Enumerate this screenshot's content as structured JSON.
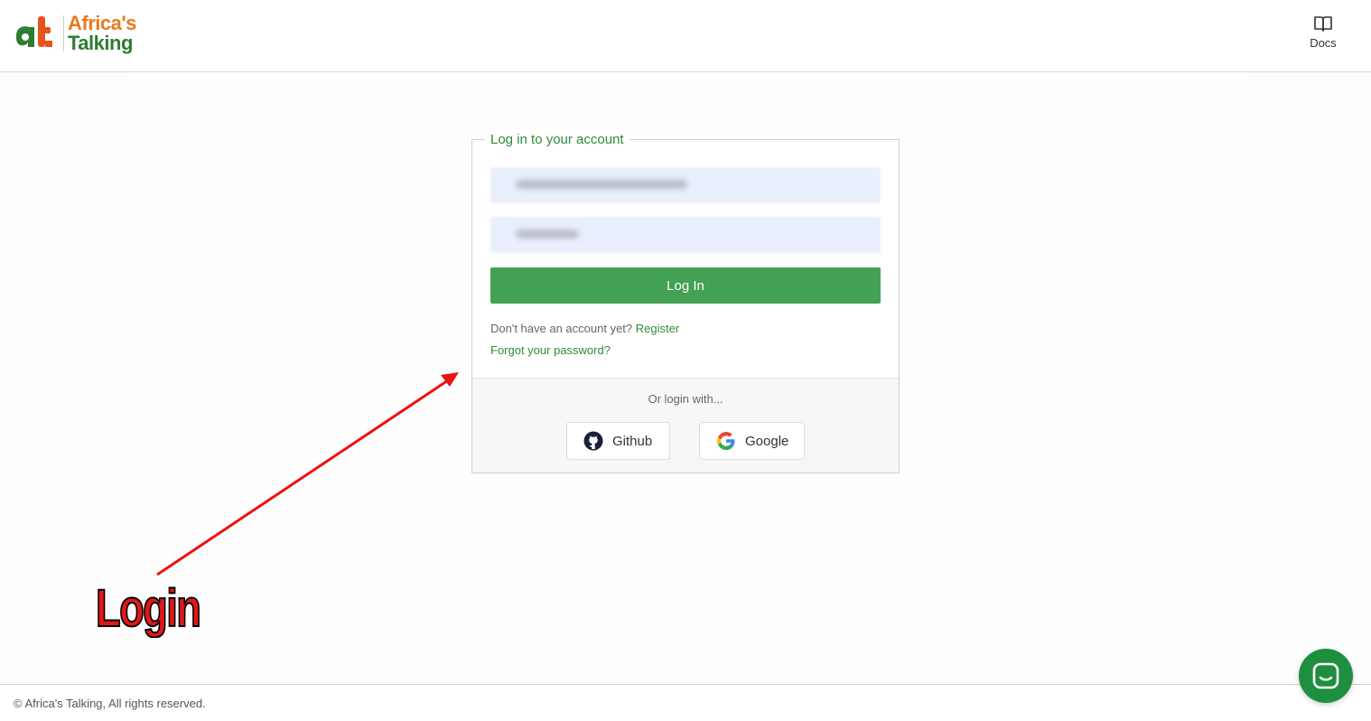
{
  "header": {
    "logo_line1": "Africa's",
    "logo_line2": "Talking",
    "docs_label": "Docs"
  },
  "login_card": {
    "legend": "Log in to your account",
    "login_button": "Log In",
    "no_account_text": "Don't have an account yet?",
    "register_link": "Register",
    "forgot_link": "Forgot your password?",
    "alt_login_label": "Or login with...",
    "github_label": "Github",
    "google_label": "Google"
  },
  "annotation": {
    "text": "Login"
  },
  "footer": {
    "copyright": "© Africa's Talking, All rights reserved."
  },
  "colors": {
    "primary_green": "#42a152",
    "link_green": "#2e8b3a",
    "logo_orange": "#e87a1b",
    "annotation_red": "#e21818"
  }
}
